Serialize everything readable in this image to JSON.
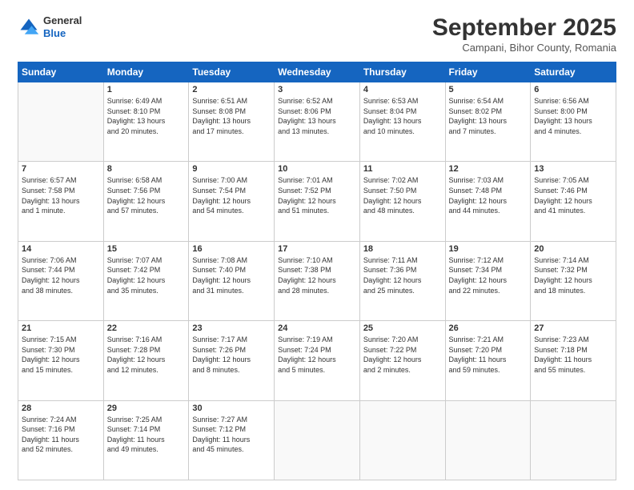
{
  "logo": {
    "general": "General",
    "blue": "Blue"
  },
  "header": {
    "month": "September 2025",
    "location": "Campani, Bihor County, Romania"
  },
  "weekdays": [
    "Sunday",
    "Monday",
    "Tuesday",
    "Wednesday",
    "Thursday",
    "Friday",
    "Saturday"
  ],
  "weeks": [
    [
      {
        "day": "",
        "info": ""
      },
      {
        "day": "1",
        "info": "Sunrise: 6:49 AM\nSunset: 8:10 PM\nDaylight: 13 hours\nand 20 minutes."
      },
      {
        "day": "2",
        "info": "Sunrise: 6:51 AM\nSunset: 8:08 PM\nDaylight: 13 hours\nand 17 minutes."
      },
      {
        "day": "3",
        "info": "Sunrise: 6:52 AM\nSunset: 8:06 PM\nDaylight: 13 hours\nand 13 minutes."
      },
      {
        "day": "4",
        "info": "Sunrise: 6:53 AM\nSunset: 8:04 PM\nDaylight: 13 hours\nand 10 minutes."
      },
      {
        "day": "5",
        "info": "Sunrise: 6:54 AM\nSunset: 8:02 PM\nDaylight: 13 hours\nand 7 minutes."
      },
      {
        "day": "6",
        "info": "Sunrise: 6:56 AM\nSunset: 8:00 PM\nDaylight: 13 hours\nand 4 minutes."
      }
    ],
    [
      {
        "day": "7",
        "info": "Sunrise: 6:57 AM\nSunset: 7:58 PM\nDaylight: 13 hours\nand 1 minute."
      },
      {
        "day": "8",
        "info": "Sunrise: 6:58 AM\nSunset: 7:56 PM\nDaylight: 12 hours\nand 57 minutes."
      },
      {
        "day": "9",
        "info": "Sunrise: 7:00 AM\nSunset: 7:54 PM\nDaylight: 12 hours\nand 54 minutes."
      },
      {
        "day": "10",
        "info": "Sunrise: 7:01 AM\nSunset: 7:52 PM\nDaylight: 12 hours\nand 51 minutes."
      },
      {
        "day": "11",
        "info": "Sunrise: 7:02 AM\nSunset: 7:50 PM\nDaylight: 12 hours\nand 48 minutes."
      },
      {
        "day": "12",
        "info": "Sunrise: 7:03 AM\nSunset: 7:48 PM\nDaylight: 12 hours\nand 44 minutes."
      },
      {
        "day": "13",
        "info": "Sunrise: 7:05 AM\nSunset: 7:46 PM\nDaylight: 12 hours\nand 41 minutes."
      }
    ],
    [
      {
        "day": "14",
        "info": "Sunrise: 7:06 AM\nSunset: 7:44 PM\nDaylight: 12 hours\nand 38 minutes."
      },
      {
        "day": "15",
        "info": "Sunrise: 7:07 AM\nSunset: 7:42 PM\nDaylight: 12 hours\nand 35 minutes."
      },
      {
        "day": "16",
        "info": "Sunrise: 7:08 AM\nSunset: 7:40 PM\nDaylight: 12 hours\nand 31 minutes."
      },
      {
        "day": "17",
        "info": "Sunrise: 7:10 AM\nSunset: 7:38 PM\nDaylight: 12 hours\nand 28 minutes."
      },
      {
        "day": "18",
        "info": "Sunrise: 7:11 AM\nSunset: 7:36 PM\nDaylight: 12 hours\nand 25 minutes."
      },
      {
        "day": "19",
        "info": "Sunrise: 7:12 AM\nSunset: 7:34 PM\nDaylight: 12 hours\nand 22 minutes."
      },
      {
        "day": "20",
        "info": "Sunrise: 7:14 AM\nSunset: 7:32 PM\nDaylight: 12 hours\nand 18 minutes."
      }
    ],
    [
      {
        "day": "21",
        "info": "Sunrise: 7:15 AM\nSunset: 7:30 PM\nDaylight: 12 hours\nand 15 minutes."
      },
      {
        "day": "22",
        "info": "Sunrise: 7:16 AM\nSunset: 7:28 PM\nDaylight: 12 hours\nand 12 minutes."
      },
      {
        "day": "23",
        "info": "Sunrise: 7:17 AM\nSunset: 7:26 PM\nDaylight: 12 hours\nand 8 minutes."
      },
      {
        "day": "24",
        "info": "Sunrise: 7:19 AM\nSunset: 7:24 PM\nDaylight: 12 hours\nand 5 minutes."
      },
      {
        "day": "25",
        "info": "Sunrise: 7:20 AM\nSunset: 7:22 PM\nDaylight: 12 hours\nand 2 minutes."
      },
      {
        "day": "26",
        "info": "Sunrise: 7:21 AM\nSunset: 7:20 PM\nDaylight: 11 hours\nand 59 minutes."
      },
      {
        "day": "27",
        "info": "Sunrise: 7:23 AM\nSunset: 7:18 PM\nDaylight: 11 hours\nand 55 minutes."
      }
    ],
    [
      {
        "day": "28",
        "info": "Sunrise: 7:24 AM\nSunset: 7:16 PM\nDaylight: 11 hours\nand 52 minutes."
      },
      {
        "day": "29",
        "info": "Sunrise: 7:25 AM\nSunset: 7:14 PM\nDaylight: 11 hours\nand 49 minutes."
      },
      {
        "day": "30",
        "info": "Sunrise: 7:27 AM\nSunset: 7:12 PM\nDaylight: 11 hours\nand 45 minutes."
      },
      {
        "day": "",
        "info": ""
      },
      {
        "day": "",
        "info": ""
      },
      {
        "day": "",
        "info": ""
      },
      {
        "day": "",
        "info": ""
      }
    ]
  ]
}
